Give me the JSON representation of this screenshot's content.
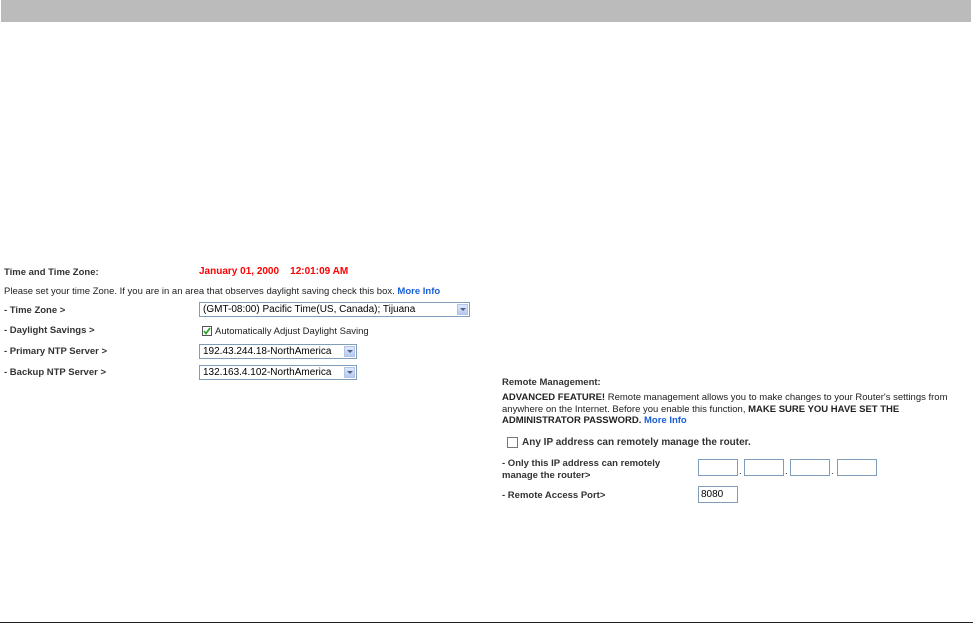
{
  "time": {
    "heading": "Time and Time Zone:",
    "datetime": "January 01, 2000    12:01:09 AM",
    "instruction": "Please set your time Zone. If you are in an area that observes daylight saving check this box.",
    "more_info": "More Info",
    "time_zone_label": "- Time Zone >",
    "time_zone_value": "(GMT-08:00) Pacific Time(US, Canada); Tijuana",
    "daylight_label": "- Daylight Savings >",
    "daylight_checkbox_label": "Automatically Adjust Daylight Saving",
    "daylight_checked": true,
    "primary_label": "- Primary NTP Server >",
    "primary_value": "192.43.244.18-NorthAmerica",
    "backup_label": "- Backup NTP Server >",
    "backup_value": "132.163.4.102-NorthAmerica"
  },
  "remote": {
    "heading": "Remote Management:",
    "p1_bold": "ADVANCED FEATURE!",
    "p1_text": " Remote management allows you to make changes to your Router's settings from anywhere on the Internet. Before you enable this function, ",
    "p1_bold2": "MAKE SURE YOU HAVE SET THE ADMINISTRATOR PASSWORD.",
    "more_info": "More Info",
    "any_ip_label": "Any IP address can remotely manage the router.",
    "any_ip_checked": false,
    "only_ip_label_1": "- Only this IP address can remotely",
    "only_ip_label_2": "manage the router>",
    "ip_octets": [
      "",
      "",
      "",
      ""
    ],
    "dot": ".",
    "port_label": "- Remote Access Port>",
    "port_value": "8080"
  }
}
